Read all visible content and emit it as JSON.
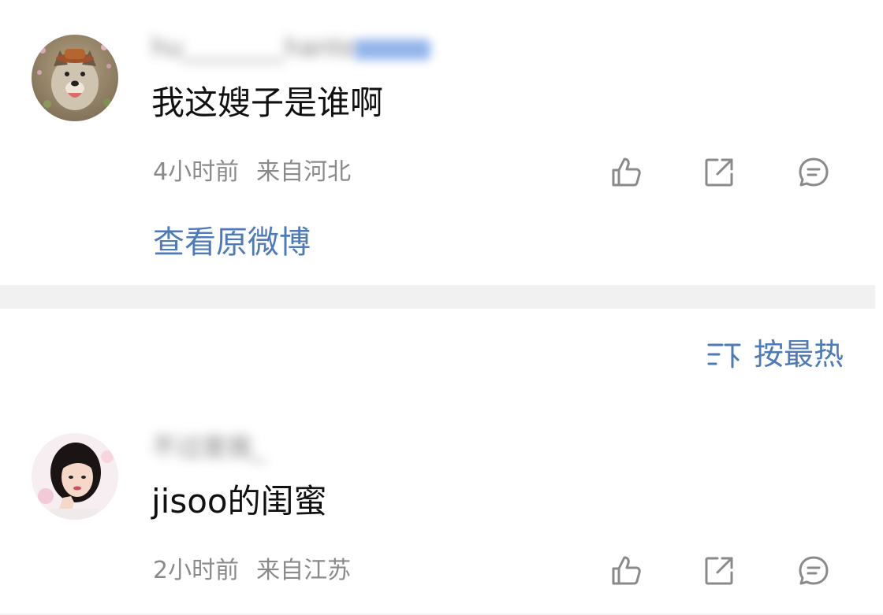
{
  "comments": [
    {
      "username": "hu________hante",
      "text": "我这嫂子是谁啊",
      "time": "4小时前",
      "location": "来自河北",
      "view_original": "查看原微博",
      "avatar": "dog-avatar"
    },
    {
      "username": "不过是我_",
      "text": "jisoo的闺蜜",
      "time": "2小时前",
      "location": "来自江苏",
      "avatar": "woman-avatar"
    }
  ],
  "sort": {
    "label": "按最热",
    "icon": "sort-icon"
  },
  "icons": {
    "like": "thumbs-up-icon",
    "repost": "share-icon",
    "comment": "comment-icon"
  },
  "colors": {
    "link_blue": "#4f7ab8",
    "meta_gray": "#8a8a8a",
    "separator": "#f1f1f1"
  }
}
